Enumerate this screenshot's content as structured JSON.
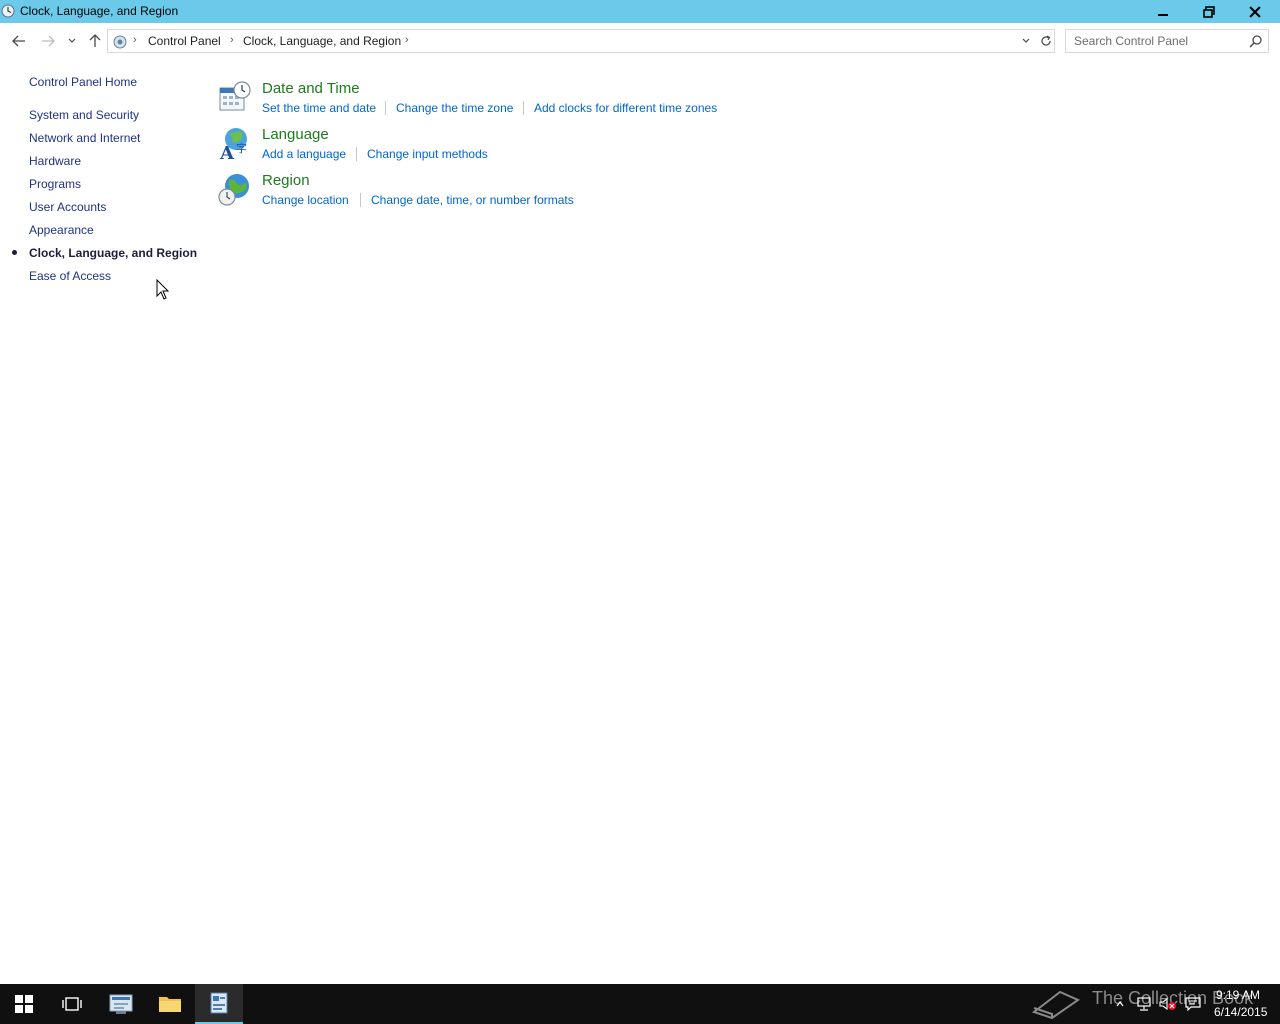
{
  "window": {
    "title": "Clock, Language, and Region",
    "accent_color": "#6bc9ea"
  },
  "address": {
    "crumbs": [
      "Control Panel",
      "Clock, Language, and Region"
    ],
    "search_placeholder": "Search Control Panel"
  },
  "sidebar": {
    "home": "Control Panel Home",
    "items": [
      "System and Security",
      "Network and Internet",
      "Hardware",
      "Programs",
      "User Accounts",
      "Appearance",
      "Clock, Language, and Region",
      "Ease of Access"
    ],
    "active_item": "Clock, Language, and Region"
  },
  "categories": [
    {
      "title": "Date and Time",
      "icon": "calendar-clock-icon",
      "tasks": [
        "Set the time and date",
        "Change the time zone",
        "Add clocks for different time zones"
      ]
    },
    {
      "title": "Language",
      "icon": "language-globe-icon",
      "tasks": [
        "Add a language",
        "Change input methods"
      ]
    },
    {
      "title": "Region",
      "icon": "region-globe-icon",
      "tasks": [
        "Change location",
        "Change date, time, or number formats"
      ]
    }
  ],
  "taskbar": {
    "watermark": "The Collection Book",
    "time": "9:19 AM",
    "date": "6/14/2015"
  }
}
